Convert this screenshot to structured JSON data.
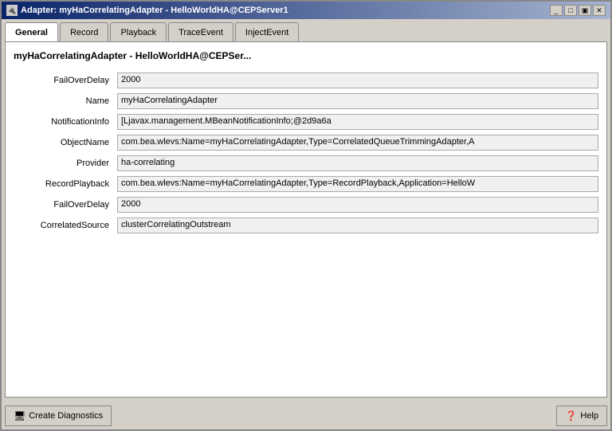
{
  "window": {
    "title": "Adapter: myHaCorrelatingAdapter - HelloWorldHA@CEPServer1",
    "title_icon": "🔌"
  },
  "title_buttons": [
    "_",
    "□",
    "▣",
    "✕"
  ],
  "tabs": [
    {
      "label": "General",
      "active": true
    },
    {
      "label": "Record",
      "active": false
    },
    {
      "label": "Playback",
      "active": false
    },
    {
      "label": "TraceEvent",
      "active": false
    },
    {
      "label": "InjectEvent",
      "active": false
    }
  ],
  "page_title": "myHaCorrelatingAdapter - HelloWorldHA@CEPSer...",
  "fields": [
    {
      "label": "FailOverDelay",
      "value": "2000"
    },
    {
      "label": "Name",
      "value": "myHaCorrelatingAdapter"
    },
    {
      "label": "NotificationInfo",
      "value": "[Ljavax.management.MBeanNotificationInfo;@2d9a6a"
    },
    {
      "label": "ObjectName",
      "value": "com.bea.wlevs:Name=myHaCorrelatingAdapter,Type=CorrelatedQueueTrimmingAdapter,A"
    },
    {
      "label": "Provider",
      "value": "ha-correlating"
    },
    {
      "label": "RecordPlayback",
      "value": "com.bea.wlevs:Name=myHaCorrelatingAdapter,Type=RecordPlayback,Application=HelloW"
    },
    {
      "label": "FailOverDelay",
      "value": "2000"
    },
    {
      "label": "CorrelatedSource",
      "value": "clusterCorrelatingOutstream"
    }
  ],
  "buttons": {
    "diagnostics": "Create Diagnostics",
    "help": "Help"
  }
}
